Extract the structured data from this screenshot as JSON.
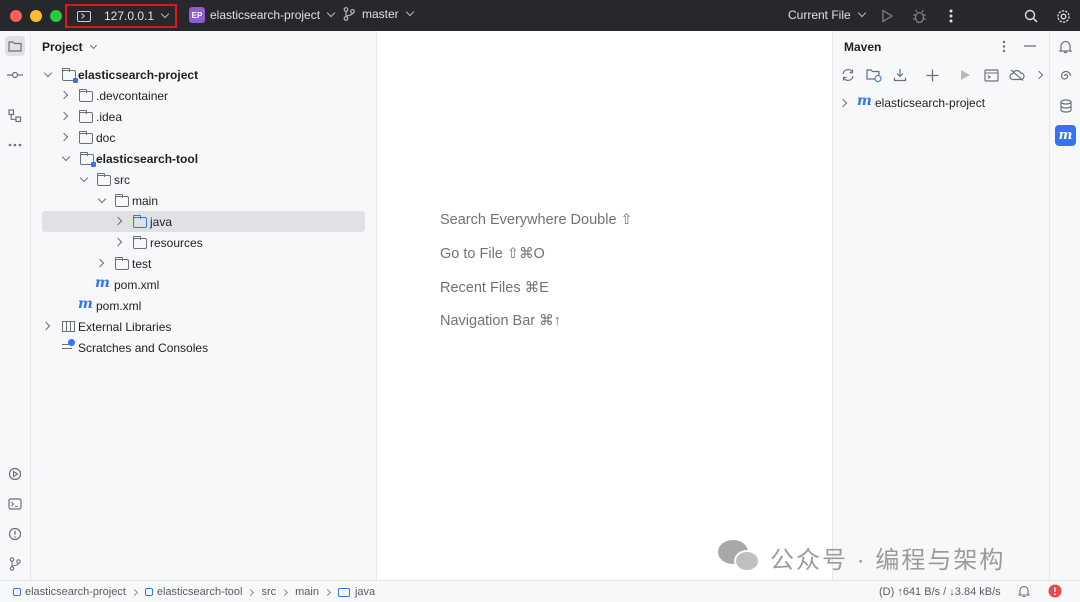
{
  "titlebar": {
    "remote_host": "127.0.0.1",
    "project_badge": "EP",
    "project_name": "elasticsearch-project",
    "branch": "master",
    "run_config": "Current File"
  },
  "project_panel": {
    "title": "Project",
    "tree": [
      {
        "label": "elasticsearch-project",
        "bold": true
      },
      {
        "label": ".devcontainer"
      },
      {
        "label": ".idea"
      },
      {
        "label": "doc"
      },
      {
        "label": "elasticsearch-tool",
        "bold": true
      },
      {
        "label": "src"
      },
      {
        "label": "main"
      },
      {
        "label": "java"
      },
      {
        "label": "resources"
      },
      {
        "label": "test"
      },
      {
        "label": "pom.xml"
      },
      {
        "label": "pom.xml"
      },
      {
        "label": "External Libraries"
      },
      {
        "label": "Scratches and Consoles"
      }
    ]
  },
  "editor": {
    "hints": [
      "Search Everywhere Double ⇧",
      "Go to File ⇧⌘O",
      "Recent Files ⌘E",
      "Navigation Bar ⌘↑"
    ]
  },
  "maven": {
    "title": "Maven",
    "item": "elasticsearch-project",
    "m_glyph": "m"
  },
  "statusbar": {
    "crumbs": [
      "elasticsearch-project",
      "elasticsearch-tool",
      "src",
      "main",
      "java"
    ],
    "network": "(D) ↑641 B/s / ↓3.84 kB/s"
  },
  "watermark": {
    "text": "公众号 · 编程与架构"
  },
  "colors": {
    "titlebar_bg": "#27282c",
    "accent": "#3574f0",
    "highlight_border": "#e0161d",
    "selection": "#dfe1e5"
  }
}
